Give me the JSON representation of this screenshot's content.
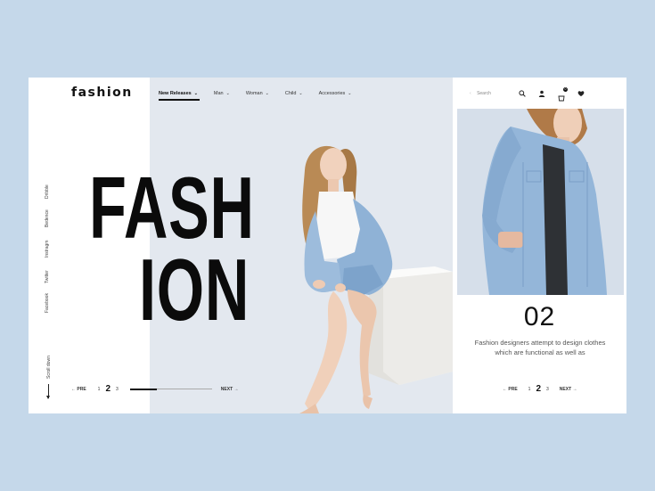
{
  "brand": {
    "logo": "fashion"
  },
  "nav": {
    "items": [
      {
        "label": "New Releases",
        "active": true
      },
      {
        "label": "Man",
        "active": false
      },
      {
        "label": "Woman",
        "active": false
      },
      {
        "label": "Child",
        "active": false
      },
      {
        "label": "Accessories",
        "active": false
      }
    ]
  },
  "header": {
    "search_placeholder": "Search",
    "icons": [
      "search-icon",
      "user-icon",
      "cart-icon",
      "heart-icon"
    ],
    "cart_badge": "0"
  },
  "social": {
    "links": [
      "Dribble",
      "Bedence",
      "Instragm",
      "Twitter",
      "Facebook"
    ],
    "scroll_label": "Scroll down"
  },
  "hero": {
    "title_line1": "FASH",
    "title_line2": "ION"
  },
  "pager_left": {
    "prev": "← PRE",
    "pages": [
      "1",
      "2",
      "3"
    ],
    "current": 2,
    "next": "NEXT →",
    "progress": 0.33
  },
  "slide": {
    "number": "02",
    "description": "Fashion designers attempt to design clothes which are functional as well as"
  },
  "pager_right": {
    "prev": "← PRE",
    "pages": [
      "1",
      "2",
      "3"
    ],
    "current": 2,
    "next": "NEXT →"
  },
  "colors": {
    "background": "#c5d8ea",
    "panel": "#e3e8ef",
    "text_dark": "#111111",
    "denim": "#8fb2d6"
  }
}
